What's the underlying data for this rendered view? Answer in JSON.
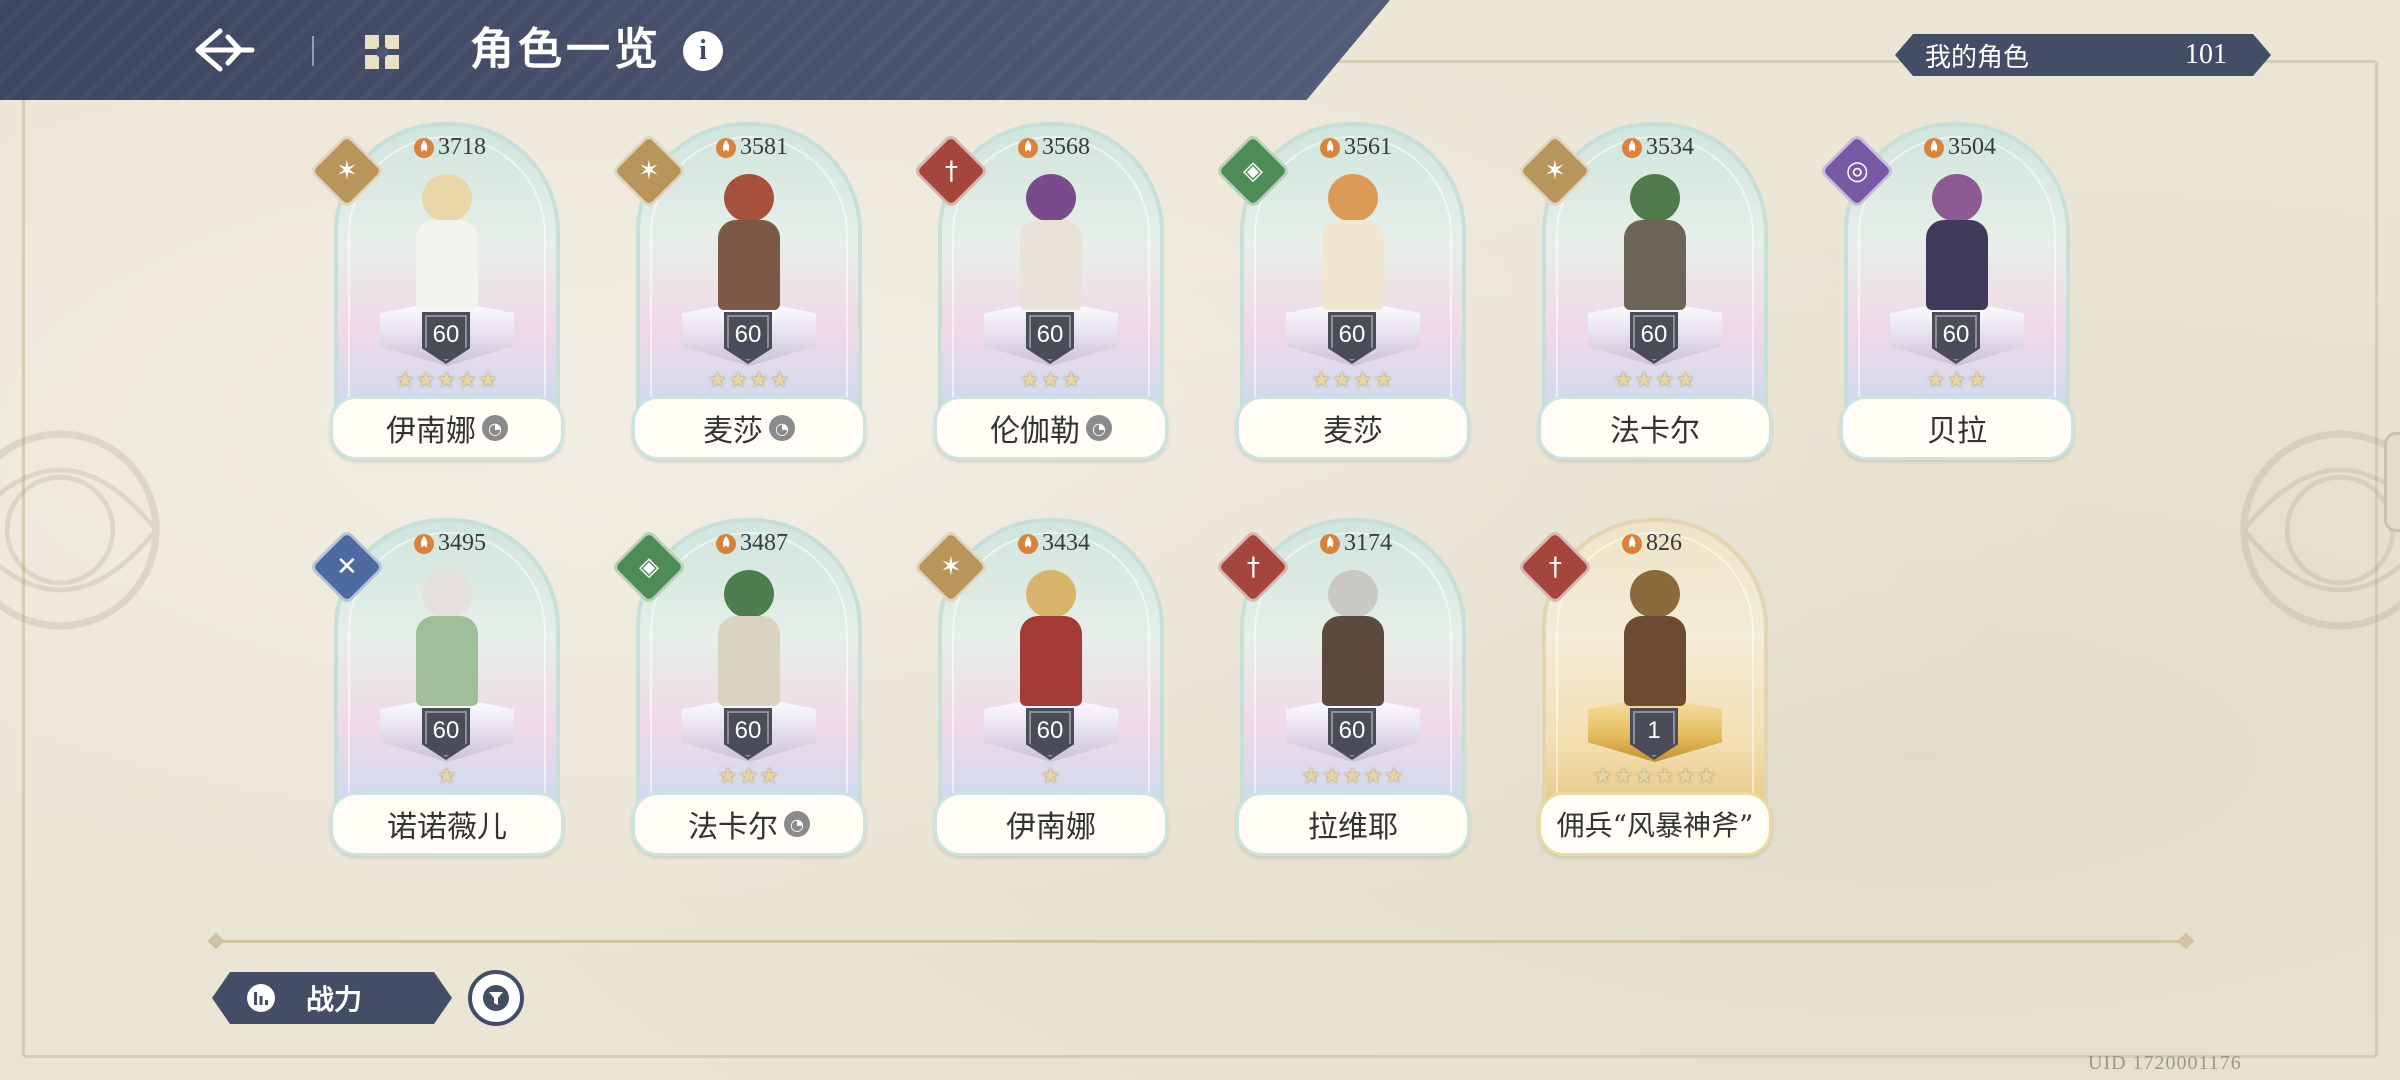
{
  "header": {
    "title": "角色一览",
    "info_icon": "i"
  },
  "my_characters": {
    "label": "我的角色",
    "count": "101"
  },
  "characters": [
    {
      "name": "伊南娜",
      "power": "3718",
      "level": "60",
      "stars": 5,
      "element": "light-icon",
      "owned_mark": true
    },
    {
      "name": "麦莎",
      "power": "3581",
      "level": "60",
      "stars": 4,
      "element": "light-icon",
      "owned_mark": true
    },
    {
      "name": "伦伽勒",
      "power": "3568",
      "level": "60",
      "stars": 3,
      "element": "fire-icon",
      "owned_mark": true
    },
    {
      "name": "麦莎",
      "power": "3561",
      "level": "60",
      "stars": 4,
      "element": "nature-icon",
      "owned_mark": false
    },
    {
      "name": "法卡尔",
      "power": "3534",
      "level": "60",
      "stars": 4,
      "element": "light-icon",
      "owned_mark": false
    },
    {
      "name": "贝拉",
      "power": "3504",
      "level": "60",
      "stars": 3,
      "element": "arcane-icon",
      "owned_mark": false
    },
    {
      "name": "诺诺薇儿",
      "power": "3495",
      "level": "60",
      "stars": 1,
      "element": "ice-icon",
      "owned_mark": false
    },
    {
      "name": "法卡尔",
      "power": "3487",
      "level": "60",
      "stars": 3,
      "element": "nature-icon",
      "owned_mark": true
    },
    {
      "name": "伊南娜",
      "power": "3434",
      "level": "60",
      "stars": 1,
      "element": "light-icon",
      "owned_mark": false
    },
    {
      "name": "拉维耶",
      "power": "3174",
      "level": "60",
      "stars": 5,
      "element": "fire-icon",
      "owned_mark": false
    },
    {
      "name": "佣兵“风暴神斧”",
      "power": "826",
      "level": "1",
      "stars": 6,
      "element": "fire-icon",
      "owned_mark": false
    }
  ],
  "bottom": {
    "sort_label": "战力",
    "uid": "UID 1720001176"
  }
}
